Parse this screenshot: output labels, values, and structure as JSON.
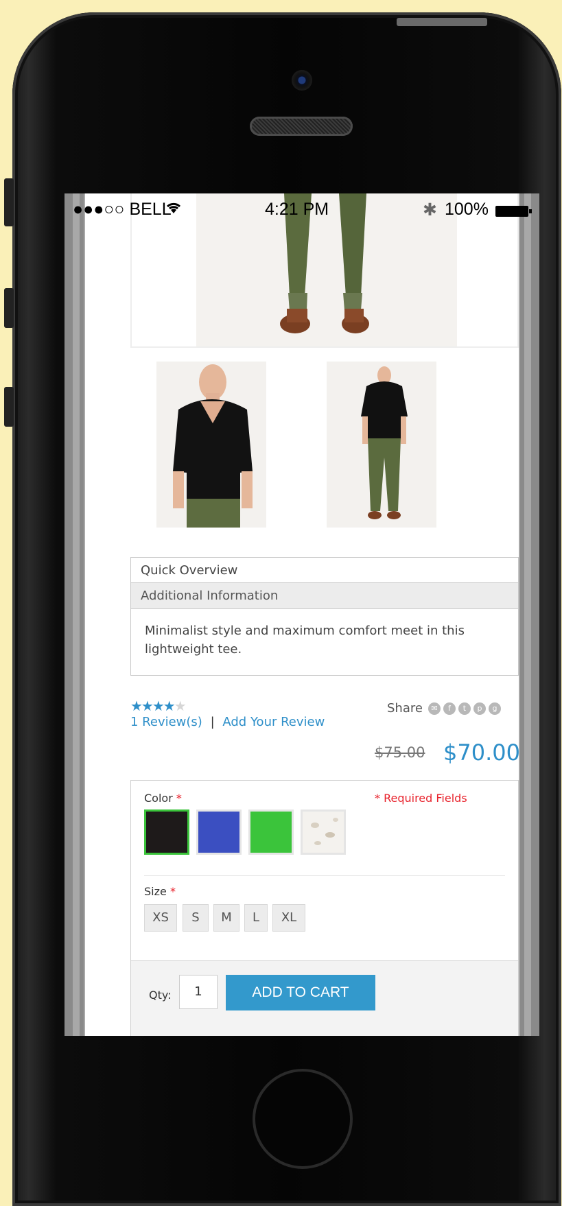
{
  "status_bar": {
    "carrier": "●●●○○ BELL",
    "wifi_icon": "wifi-icon",
    "time": "4:21 PM",
    "bluetooth_icon": "bluetooth-icon",
    "battery": "100%"
  },
  "product": {
    "tabs": [
      {
        "label": "Quick Overview",
        "active": false
      },
      {
        "label": "Additional Information",
        "active": true
      }
    ],
    "description": "Minimalist style and maximum comfort meet in this lightweight tee.",
    "rating": {
      "stars_filled": 4,
      "stars_total": 5
    },
    "reviews_link": "1 Review(s)",
    "separator": "|",
    "add_review_link": "Add Your Review",
    "share_label": "Share",
    "share_icons": [
      "email-icon",
      "facebook-icon",
      "twitter-icon",
      "pinterest-icon",
      "google-plus-icon"
    ],
    "old_price": "$75.00",
    "price": "$70.00"
  },
  "options": {
    "color_label": "Color",
    "required_marker": "*",
    "required_fields": "* Required Fields",
    "colors": [
      {
        "name": "black",
        "hex": "#1e1a1a",
        "selected": true
      },
      {
        "name": "blue",
        "hex": "#3b4fc1",
        "selected": false
      },
      {
        "name": "green",
        "hex": "#3bc43b",
        "selected": false
      },
      {
        "name": "white lace",
        "hex": "#f4f2ee",
        "selected": false
      }
    ],
    "size_label": "Size",
    "sizes": [
      "XS",
      "S",
      "M",
      "L",
      "XL"
    ],
    "qty_label": "Qty:",
    "qty_value": "1",
    "add_to_cart": "ADD TO CART"
  },
  "colors": {
    "accent": "#2e8fc9",
    "button": "#3399cc",
    "required": "#e8212b",
    "background": "#faf0b8"
  }
}
